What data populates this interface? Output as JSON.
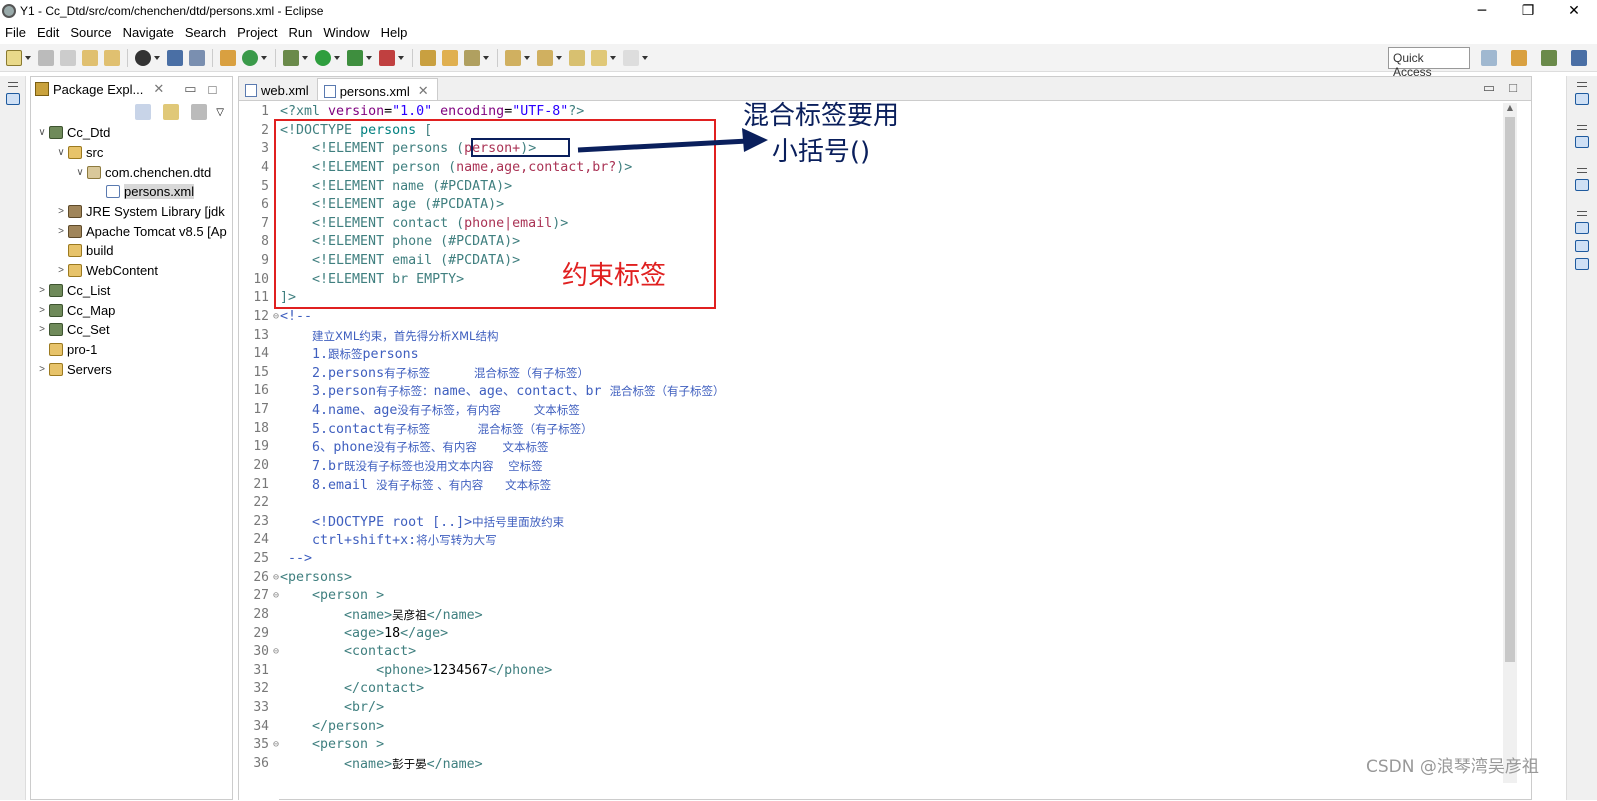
{
  "window": {
    "title": "Y1 - Cc_Dtd/src/com/chenchen/dtd/persons.xml - Eclipse",
    "controls": [
      "─",
      "❐",
      "✕"
    ]
  },
  "menu": [
    "File",
    "Edit",
    "Source",
    "Navigate",
    "Search",
    "Project",
    "Run",
    "Window",
    "Help"
  ],
  "toolbar": {
    "quick_access": "Quick Access"
  },
  "package_explorer": {
    "title": "Package Expl...",
    "items": [
      {
        "label": "Cc_Dtd",
        "icon": "project-icon",
        "arrow": "∨",
        "indent": 0
      },
      {
        "label": "src",
        "icon": "source-folder-icon",
        "arrow": "∨",
        "indent": 1
      },
      {
        "label": "com.chenchen.dtd",
        "icon": "package-icon",
        "arrow": "∨",
        "indent": 2
      },
      {
        "label": "persons.xml",
        "icon": "xml-file-icon",
        "arrow": "",
        "indent": 3,
        "selected": true
      },
      {
        "label": "JRE System Library [jdk",
        "icon": "library-icon",
        "arrow": ">",
        "indent": 1
      },
      {
        "label": "Apache Tomcat v8.5 [Ap",
        "icon": "library-icon",
        "arrow": ">",
        "indent": 1
      },
      {
        "label": "build",
        "icon": "folder-icon",
        "arrow": "",
        "indent": 1
      },
      {
        "label": "WebContent",
        "icon": "folder-icon",
        "arrow": ">",
        "indent": 1
      },
      {
        "label": "Cc_List",
        "icon": "project-icon",
        "arrow": ">",
        "indent": 0
      },
      {
        "label": "Cc_Map",
        "icon": "project-icon",
        "arrow": ">",
        "indent": 0
      },
      {
        "label": "Cc_Set",
        "icon": "project-icon",
        "arrow": ">",
        "indent": 0
      },
      {
        "label": "pro-1",
        "icon": "folder-icon",
        "arrow": "",
        "indent": 0
      },
      {
        "label": "Servers",
        "icon": "folder-icon",
        "arrow": ">",
        "indent": 0
      }
    ]
  },
  "editor": {
    "tabs": [
      {
        "label": "web.xml",
        "active": false
      },
      {
        "label": "persons.xml",
        "active": true
      }
    ],
    "lines": [
      {
        "n": "1",
        "fold": "",
        "segs": [
          [
            "<?xml ",
            "#3f7f7f"
          ],
          [
            "version",
            "#7f007f"
          ],
          [
            "=",
            "#000"
          ],
          [
            "\"1.0\"",
            "#2a00ff"
          ],
          [
            " encoding",
            "#7f007f"
          ],
          [
            "=",
            "#000"
          ],
          [
            "\"UTF-8\"",
            "#2a00ff"
          ],
          [
            "?>",
            "#3f7f7f"
          ]
        ]
      },
      {
        "n": "2",
        "fold": "",
        "segs": [
          [
            "<!DOCTYPE ",
            "#3f7f7f"
          ],
          [
            "persons",
            "#008080"
          ],
          [
            " [",
            "#3f7f7f"
          ]
        ]
      },
      {
        "n": "3",
        "fold": "",
        "segs": [
          [
            "    <!ELEMENT ",
            "#3f7f7f"
          ],
          [
            "persons ",
            "#3f7f7f"
          ],
          [
            "(",
            "#3f7f7f"
          ],
          [
            "person+",
            "#aa3355"
          ],
          [
            ")>",
            "#3f7f7f"
          ]
        ]
      },
      {
        "n": "4",
        "fold": "",
        "segs": [
          [
            "    <!ELEMENT ",
            "#3f7f7f"
          ],
          [
            "person ",
            "#3f7f7f"
          ],
          [
            "(",
            "#3f7f7f"
          ],
          [
            "name,age,contact,br?",
            "#aa3355"
          ],
          [
            ")>",
            "#3f7f7f"
          ]
        ]
      },
      {
        "n": "5",
        "fold": "",
        "segs": [
          [
            "    <!ELEMENT name (#PCDATA)>",
            "#3f7f7f"
          ]
        ]
      },
      {
        "n": "6",
        "fold": "",
        "segs": [
          [
            "    <!ELEMENT age (#PCDATA)>",
            "#3f7f7f"
          ]
        ]
      },
      {
        "n": "7",
        "fold": "",
        "segs": [
          [
            "    <!ELEMENT contact ",
            "#3f7f7f"
          ],
          [
            "(",
            "#3f7f7f"
          ],
          [
            "phone|email",
            "#aa3355"
          ],
          [
            ")>",
            "#3f7f7f"
          ]
        ]
      },
      {
        "n": "8",
        "fold": "",
        "segs": [
          [
            "    <!ELEMENT phone (#PCDATA)>",
            "#3f7f7f"
          ]
        ]
      },
      {
        "n": "9",
        "fold": "",
        "segs": [
          [
            "    <!ELEMENT email (#PCDATA)>",
            "#3f7f7f"
          ]
        ]
      },
      {
        "n": "10",
        "fold": "",
        "segs": [
          [
            "    <!ELEMENT br EMPTY>",
            "#3f7f7f"
          ]
        ]
      },
      {
        "n": "11",
        "fold": "",
        "segs": [
          [
            "]>",
            "#3f7f7f"
          ]
        ]
      },
      {
        "n": "12",
        "fold": "⊖",
        "segs": [
          [
            "<!--",
            "#3f5fbf"
          ]
        ]
      },
      {
        "n": "13",
        "fold": "",
        "segs": [
          [
            "    ",
            "#3f5fbf"
          ],
          [
            "建立XML约束，首先得分析XML结构",
            "#3f5fbf",
            "zh"
          ]
        ]
      },
      {
        "n": "14",
        "fold": "",
        "segs": [
          [
            "    1.",
            "#3f5fbf"
          ],
          [
            "跟标签",
            "#3f5fbf",
            "zh"
          ],
          [
            "persons",
            "#3f5fbf"
          ]
        ]
      },
      {
        "n": "15",
        "fold": "",
        "segs": [
          [
            "    2.persons",
            "#3f5fbf"
          ],
          [
            "有子标签            混合标签（有子标签）",
            "#3f5fbf",
            "zh"
          ]
        ]
      },
      {
        "n": "16",
        "fold": "",
        "segs": [
          [
            "    3.person",
            "#3f5fbf"
          ],
          [
            "有子标签：",
            "#3f5fbf",
            "zh"
          ],
          [
            "name、age、contact、br ",
            "#3f5fbf"
          ],
          [
            "混合标签（有子标签）",
            "#3f5fbf",
            "zh"
          ]
        ]
      },
      {
        "n": "17",
        "fold": "",
        "segs": [
          [
            "    4.name、age",
            "#3f5fbf"
          ],
          [
            "没有子标签，有内容         文本标签",
            "#3f5fbf",
            "zh"
          ]
        ]
      },
      {
        "n": "18",
        "fold": "",
        "segs": [
          [
            "    5.contact",
            "#3f5fbf"
          ],
          [
            "有子标签             混合标签（有子标签）",
            "#3f5fbf",
            "zh"
          ]
        ]
      },
      {
        "n": "19",
        "fold": "",
        "segs": [
          [
            "    6、phone",
            "#3f5fbf"
          ],
          [
            "没有子标签、有内容       文本标签",
            "#3f5fbf",
            "zh"
          ]
        ]
      },
      {
        "n": "20",
        "fold": "",
        "segs": [
          [
            "    7.br",
            "#3f5fbf"
          ],
          [
            "既没有子标签也没用文本内容    空标签",
            "#3f5fbf",
            "zh"
          ]
        ]
      },
      {
        "n": "21",
        "fold": "",
        "segs": [
          [
            "    8.email ",
            "#3f5fbf"
          ],
          [
            "没有子标签 、有内容      文本标签",
            "#3f5fbf",
            "zh"
          ]
        ]
      },
      {
        "n": "22",
        "fold": "",
        "segs": [
          [
            "",
            "#3f5fbf"
          ]
        ]
      },
      {
        "n": "23",
        "fold": "",
        "segs": [
          [
            "    <!DOCTYPE root [..]>",
            "#3f5fbf"
          ],
          [
            "中括号里面放约束",
            "#3f5fbf",
            "zh"
          ]
        ]
      },
      {
        "n": "24",
        "fold": "",
        "segs": [
          [
            "    ctrl+shift+x:",
            "#3f5fbf"
          ],
          [
            "将小写转为大写",
            "#3f5fbf",
            "zh"
          ]
        ]
      },
      {
        "n": "25",
        "fold": "",
        "segs": [
          [
            " -->",
            "#3f5fbf"
          ]
        ]
      },
      {
        "n": "26",
        "fold": "⊖",
        "segs": [
          [
            "<persons>",
            "#3f7f7f"
          ]
        ]
      },
      {
        "n": "27",
        "fold": "⊖",
        "segs": [
          [
            "    <person >",
            "#3f7f7f"
          ]
        ]
      },
      {
        "n": "28",
        "fold": "",
        "segs": [
          [
            "        <name>",
            "#3f7f7f"
          ],
          [
            "吴彦祖",
            "#000",
            "zh"
          ],
          [
            "</name>",
            "#3f7f7f"
          ]
        ]
      },
      {
        "n": "29",
        "fold": "",
        "segs": [
          [
            "        <age>",
            "#3f7f7f"
          ],
          [
            "18",
            "#000"
          ],
          [
            "</age>",
            "#3f7f7f"
          ]
        ]
      },
      {
        "n": "30",
        "fold": "⊖",
        "segs": [
          [
            "        <contact>",
            "#3f7f7f"
          ]
        ]
      },
      {
        "n": "31",
        "fold": "",
        "segs": [
          [
            "            <phone>",
            "#3f7f7f"
          ],
          [
            "1234567",
            "#000"
          ],
          [
            "</phone>",
            "#3f7f7f"
          ]
        ]
      },
      {
        "n": "32",
        "fold": "",
        "segs": [
          [
            "        </contact>",
            "#3f7f7f"
          ]
        ]
      },
      {
        "n": "33",
        "fold": "",
        "segs": [
          [
            "        <br/>",
            "#3f7f7f"
          ]
        ]
      },
      {
        "n": "34",
        "fold": "",
        "segs": [
          [
            "    </person>",
            "#3f7f7f"
          ]
        ]
      },
      {
        "n": "35",
        "fold": "⊖",
        "segs": [
          [
            "    <person >",
            "#3f7f7f"
          ]
        ]
      },
      {
        "n": "36",
        "fold": "",
        "segs": [
          [
            "        <name>",
            "#3f7f7f"
          ],
          [
            "彭于晏",
            "#000",
            "zh"
          ],
          [
            "</name>",
            "#3f7f7f"
          ]
        ]
      }
    ]
  },
  "annotations": {
    "mixed_tag_note_line1": "混合标签要用",
    "mixed_tag_note_line2": "小括号()",
    "constraint_note": "约束标签",
    "colors": {
      "red": "#e02020",
      "navy": "#0a1f5c"
    }
  },
  "watermark": "CSDN @浪琴湾吴彦祖"
}
